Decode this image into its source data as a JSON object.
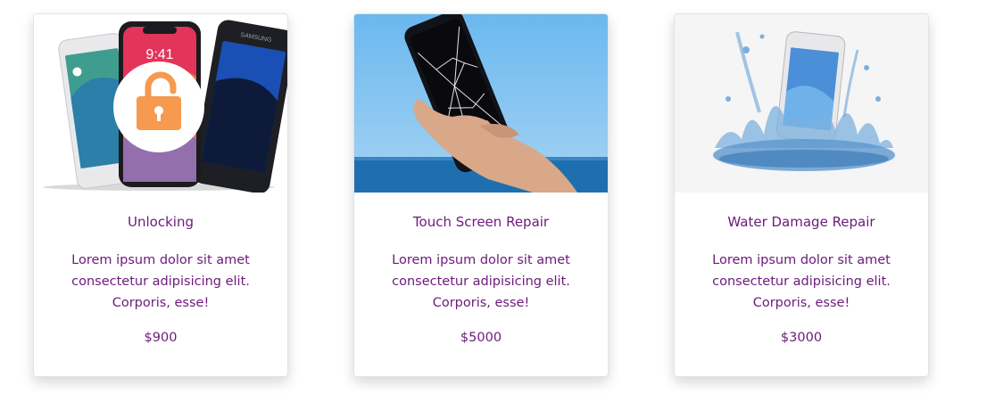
{
  "services": [
    {
      "title": "Unlocking",
      "description": "Lorem ipsum dolor sit amet consectetur adipisicing elit. Corporis, esse!",
      "price": "$900",
      "image": "unlocked-phones-image",
      "phone_time": "9:41",
      "phone_brand": "SAMSUNG"
    },
    {
      "title": "Touch Screen Repair",
      "description": "Lorem ipsum dolor sit amet consectetur adipisicing elit. Corporis, esse!",
      "price": "$5000",
      "image": "cracked-screen-phone-image"
    },
    {
      "title": "Water Damage Repair",
      "description": "Lorem ipsum dolor sit amet consectetur adipisicing elit. Corporis, esse!",
      "price": "$3000",
      "image": "water-splash-phone-image"
    }
  ],
  "colors": {
    "text": "#6b1a7a",
    "lock_orange": "#f59a4e",
    "sky_blue": "#6ab8ef",
    "sea_blue": "#1f6fb0"
  }
}
